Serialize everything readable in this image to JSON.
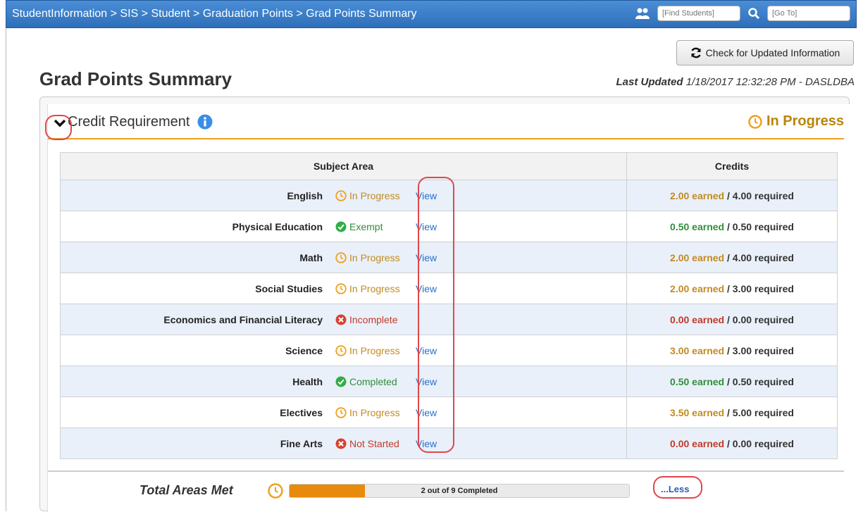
{
  "topbar": {
    "breadcrumb": "StudentInformation > SIS > Student > Graduation Points > Grad Points Summary",
    "find_placeholder": "[Find Students]",
    "goto_placeholder": "[Go To]"
  },
  "header": {
    "check_button_label": "Check for Updated Information",
    "page_title": "Grad Points Summary",
    "last_updated_label": "Last Updated",
    "last_updated_value": "1/18/2017 12:32:28 PM - DASLDBA"
  },
  "section": {
    "title": "Credit Requirement",
    "status": "In Progress",
    "columns": {
      "subject": "Subject Area",
      "credits": "Credits"
    },
    "rows": [
      {
        "subject": "English",
        "status": "In Progress",
        "status_type": "progress",
        "view": "View",
        "earned": "2.00 earned",
        "required": "4.00 required"
      },
      {
        "subject": "Physical Education",
        "status": "Exempt",
        "status_type": "ok",
        "view": "View",
        "earned": "0.50 earned",
        "required": "0.50 required"
      },
      {
        "subject": "Math",
        "status": "In Progress",
        "status_type": "progress",
        "view": "View",
        "earned": "2.00 earned",
        "required": "4.00 required"
      },
      {
        "subject": "Social Studies",
        "status": "In Progress",
        "status_type": "progress",
        "view": "View",
        "earned": "2.00 earned",
        "required": "3.00 required"
      },
      {
        "subject": "Economics and Financial Literacy",
        "status": "Incomplete",
        "status_type": "bad",
        "view": "",
        "earned": "0.00 earned",
        "required": "0.00 required"
      },
      {
        "subject": "Science",
        "status": "In Progress",
        "status_type": "progress",
        "view": "View",
        "earned": "3.00 earned",
        "required": "3.00 required"
      },
      {
        "subject": "Health",
        "status": "Completed",
        "status_type": "ok",
        "view": "View",
        "earned": "0.50 earned",
        "required": "0.50 required"
      },
      {
        "subject": "Electives",
        "status": "In Progress",
        "status_type": "progress",
        "view": "View",
        "earned": "3.50 earned",
        "required": "5.00 required"
      },
      {
        "subject": "Fine Arts",
        "status": "Not Started",
        "status_type": "bad",
        "view": "View",
        "earned": "0.00 earned",
        "required": "0.00 required"
      }
    ]
  },
  "footer": {
    "total_label": "Total Areas Met",
    "progress_text": "2 out of 9 Completed",
    "progress_fraction": 0.222,
    "less_link": "...Less"
  },
  "icons": {
    "progress": "clock-icon",
    "ok": "check-circle-icon",
    "bad": "x-circle-icon"
  },
  "colors": {
    "topbar": "#2f6fba",
    "progress": "#e88a0c",
    "ok": "#2f8f3a",
    "bad": "#c03a2b",
    "link": "#2a6fc9",
    "section_underline": "#f0a020"
  }
}
